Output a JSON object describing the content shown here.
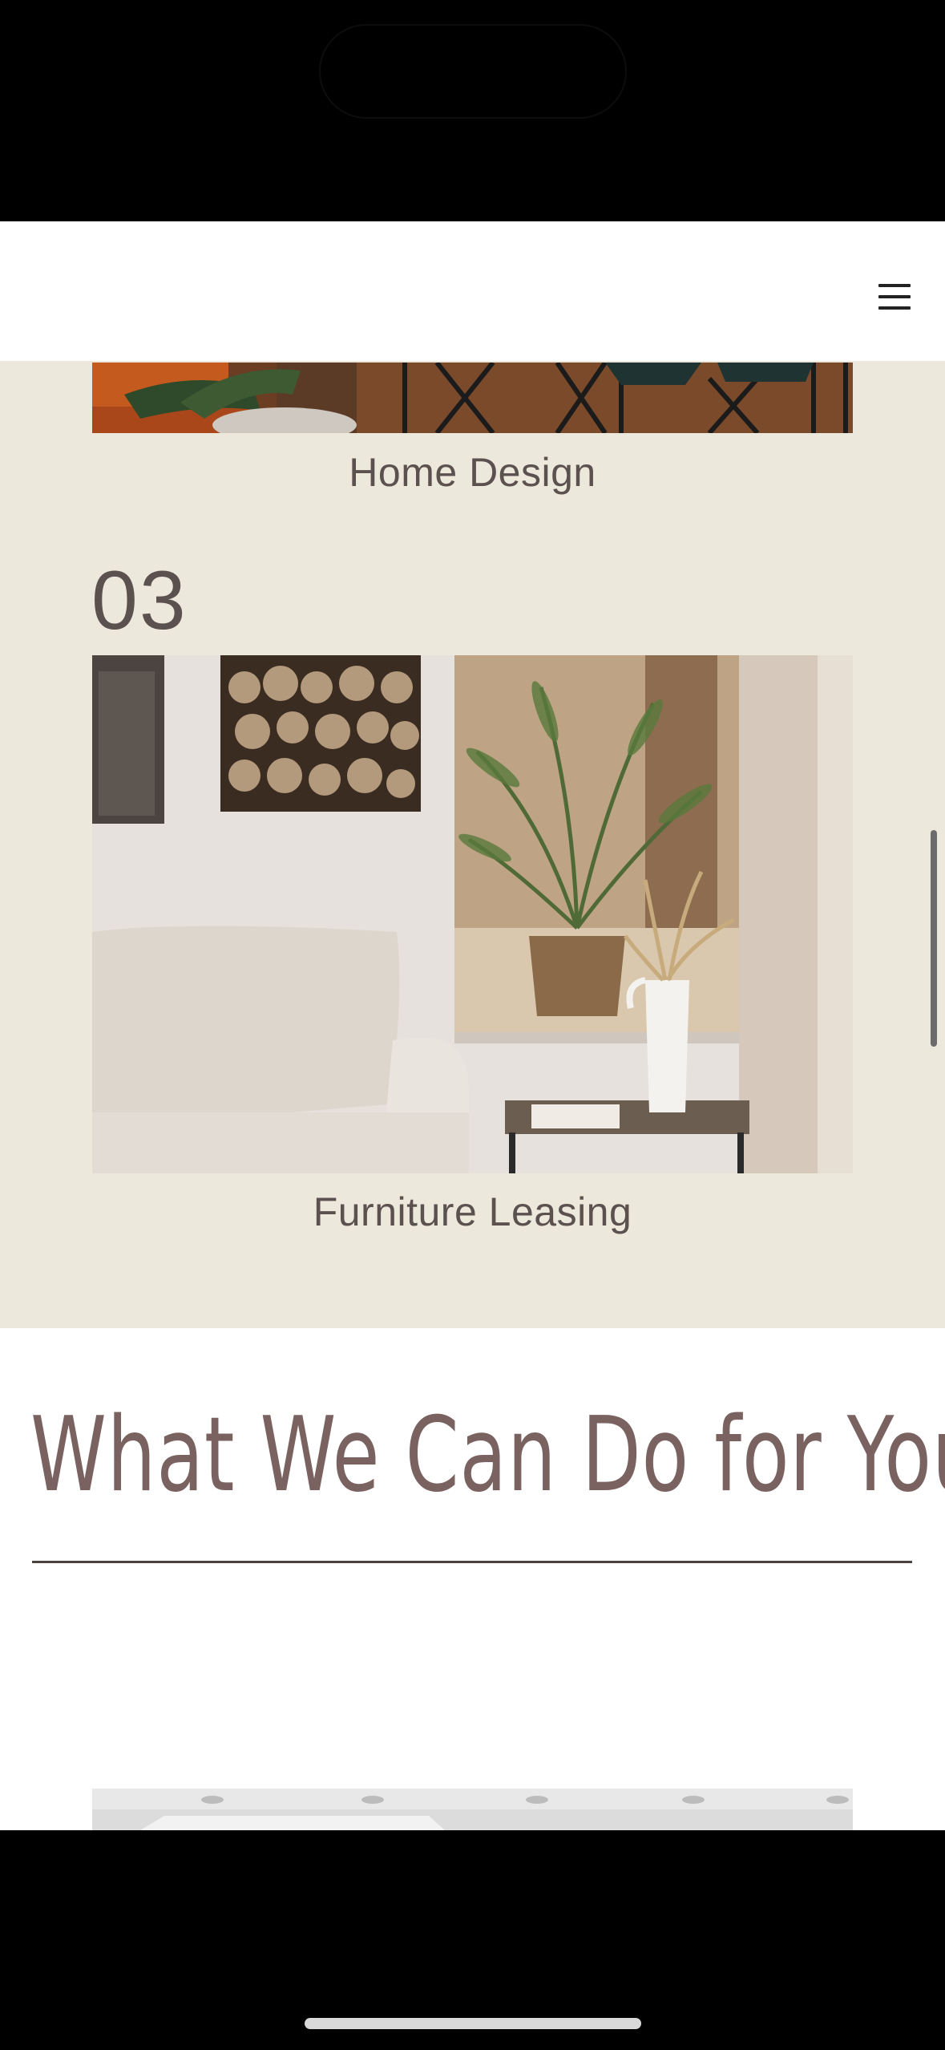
{
  "header": {
    "menu_icon": "hamburger-menu-icon"
  },
  "services": [
    {
      "number": "",
      "caption": "Home Design"
    },
    {
      "number": "03",
      "caption": "Furniture Leasing"
    }
  ],
  "section": {
    "title": "What We Can Do for You"
  },
  "colors": {
    "beige_background": "#ede8dc",
    "text_dark": "#5b514f",
    "title_mauve": "#7a6261",
    "header_background": "#ffffff"
  }
}
